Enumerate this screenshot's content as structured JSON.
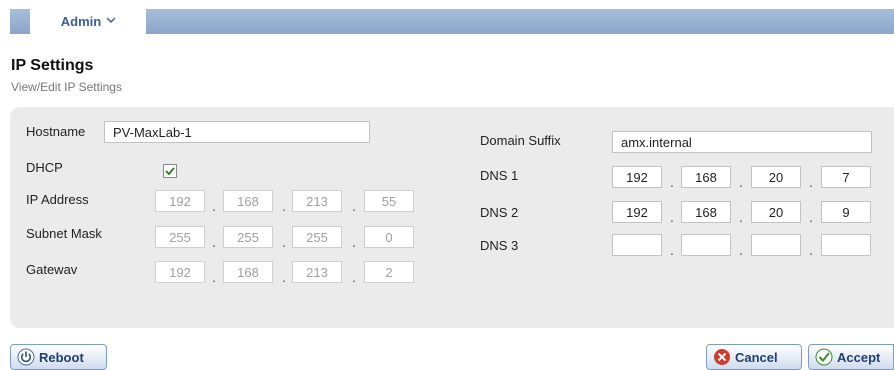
{
  "nav": {
    "admin_label": "Admin"
  },
  "page": {
    "title": "IP Settings",
    "subtitle": "View/Edit IP Settings"
  },
  "form": {
    "hostname_label": "Hostname",
    "hostname_value": "PV-MaxLab-1",
    "dhcp_label": "DHCP",
    "dhcp_checked": true,
    "ip_address_label": "IP Address",
    "ip_address": [
      "192",
      "168",
      "213",
      "55"
    ],
    "subnet_mask_label": "Subnet Mask",
    "subnet_mask": [
      "255",
      "255",
      "255",
      "0"
    ],
    "gateway_label": "Gatewav",
    "gateway": [
      "192",
      "168",
      "213",
      "2"
    ],
    "domain_suffix_label": "Domain Suffix",
    "domain_suffix_value": "amx.internal",
    "dns1_label": "DNS 1",
    "dns1": [
      "192",
      "168",
      "20",
      "7"
    ],
    "dns2_label": "DNS 2",
    "dns2": [
      "192",
      "168",
      "20",
      "9"
    ],
    "dns3_label": "DNS 3",
    "dns3": [
      "",
      "",
      "",
      ""
    ],
    "separator": "."
  },
  "buttons": {
    "reboot": "Reboot",
    "cancel": "Cancel",
    "accept": "Accept"
  },
  "colors": {
    "nav_bar": "#8aa6c9",
    "panel_bg": "#ebebeb",
    "cancel_icon": "#d03a2f",
    "accept_icon": "#3b8a2a"
  },
  "icons": {
    "nav": "chevron-down-icon",
    "dhcp": "check-icon",
    "reboot": "power-icon",
    "cancel": "cancel-x-icon",
    "accept": "accept-check-icon"
  }
}
